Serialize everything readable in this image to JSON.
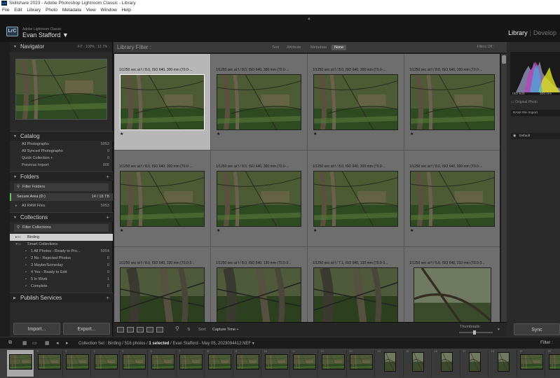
{
  "window": {
    "title": "Skillshare 2023 - Adobe Photoshop Lightroom Classic - Library",
    "app_icon": "Lrc"
  },
  "menu": [
    "File",
    "Edit",
    "Library",
    "Photo",
    "Metadata",
    "View",
    "Window",
    "Help"
  ],
  "identity": {
    "logo": "LrC",
    "product": "Adobe Lightroom Classic",
    "user": "Evan Stafford",
    "user_caret": "▼",
    "modules": [
      "Library",
      "Develop"
    ],
    "module_separator": "|",
    "active_module": "Library"
  },
  "navigator": {
    "title": "Navigator",
    "zoom": "FIT  :  100%  :  12.7%  :"
  },
  "catalog": {
    "title": "Catalog",
    "items": [
      {
        "label": "All Photographs",
        "count": "5053"
      },
      {
        "label": "All Synced Photographs",
        "count": "0"
      },
      {
        "label": "Quick Collection +",
        "count": "0"
      },
      {
        "label": "Previous Import",
        "count": "806"
      }
    ]
  },
  "folders": {
    "title": "Folders",
    "filter_label": "Filter Folders",
    "volume": {
      "label": "Secure Area (D:)",
      "count": "14 / 18 TB"
    },
    "items": [
      {
        "label": "All RAW Files",
        "count": "5053"
      }
    ]
  },
  "collections": {
    "title": "Collections",
    "filter_label": "Filter Collections",
    "items": [
      {
        "label": "Birding",
        "count": ""
      },
      {
        "label": "Smart Collections",
        "count": ""
      },
      {
        "label": "1 All Photos - Ready to Pro...",
        "count": "5054"
      },
      {
        "label": "2 No - Rejected Photos",
        "count": "0"
      },
      {
        "label": "3 Maybe/Someday",
        "count": "0"
      },
      {
        "label": "4 Yes - Ready to Edit",
        "count": "0"
      },
      {
        "label": "5 In Work",
        "count": "1"
      },
      {
        "label": "Complete",
        "count": "0"
      }
    ]
  },
  "publish_services": {
    "title": "Publish Services"
  },
  "buttons": {
    "import": "Import...",
    "export": "Export...",
    "sync": "Sync"
  },
  "library_filter": {
    "title": "Library Filter :",
    "options": [
      "Text",
      "Attribute",
      "Metadata",
      "None"
    ],
    "selected": "None",
    "status": "Filters Off :"
  },
  "grid": {
    "cells": [
      {
        "caption": "1/1250 sec at f / 8.0, ISO 640, 300 mm (70.0-...",
        "star": "★",
        "selected": true,
        "scene": "a"
      },
      {
        "caption": "1/1250 sec at f / 8.0, ISO 640, 300 mm (70.0-...",
        "star": "★",
        "selected": false,
        "scene": "a"
      },
      {
        "caption": "1/1250 sec at f / 8.0, ISO 640, 300 mm (70.0-...",
        "star": "★",
        "selected": false,
        "scene": "a"
      },
      {
        "caption": "1/1250 sec at f / 8.0, ISO 640, 300 mm (70.0-...",
        "star": "★",
        "selected": false,
        "scene": "a"
      },
      {
        "caption": "1/1250 sec at f / 8.0, ISO 640, 300 mm (70.0-...",
        "star": "★",
        "selected": false,
        "scene": "a"
      },
      {
        "caption": "1/1250 sec at f / 8.0, ISO 640, 300 mm (70.0-...",
        "star": "★",
        "selected": false,
        "scene": "a"
      },
      {
        "caption": "1/1250 sec at f / 8.0, ISO 640, 300 mm (70.0-...",
        "star": "★",
        "selected": false,
        "scene": "a"
      },
      {
        "caption": "1/1250 sec at f / 8.0, ISO 640, 300 mm (70.0-...",
        "star": "★",
        "selected": false,
        "scene": "a"
      },
      {
        "caption": "1/1250 sec at f / 8.0, ISO 640, 130 mm (70.0-3...",
        "star": "",
        "selected": false,
        "scene": "b"
      },
      {
        "caption": "1/1250 sec at f / 8.0, ISO 640, 130 mm (70.0-3...",
        "star": "",
        "selected": false,
        "scene": "b"
      },
      {
        "caption": "1/1250 sec at f / 7.1, ISO 640, 130 mm (70.0-3...",
        "star": "",
        "selected": false,
        "scene": "b"
      },
      {
        "caption": "1/1250 sec at f / 5.6, ISO 640, 210 mm (70.0-3...",
        "star": "",
        "selected": false,
        "scene": "c"
      }
    ]
  },
  "toolbar": {
    "sort_label": "Sort:",
    "sort_value": "Capture Time ÷",
    "thumbnails_label": "Thumbnails",
    "thumbnail_size": 0.45
  },
  "histogram": {
    "iso": "ISO 640",
    "focal": "300 mm",
    "aperture": "f / 8.0",
    "original_label": "Original Photo",
    "raw_import": "RAW File Import",
    "default_preset": "Default"
  },
  "filmstrip_bar": {
    "source": "Collection Set : Birding",
    "count": "516 photos /",
    "selected": "1 selected",
    "file": "/ Evan Stafford - May 05, 2023094412.NEF",
    "filter": "Filter :"
  },
  "filmstrip": {
    "items": [
      {
        "n": "1",
        "tall": false,
        "sel": true
      },
      {
        "n": "2",
        "tall": false,
        "sel": false
      },
      {
        "n": "3",
        "tall": false,
        "sel": false
      },
      {
        "n": "4",
        "tall": false,
        "sel": false
      },
      {
        "n": "5",
        "tall": false,
        "sel": false
      },
      {
        "n": "6",
        "tall": false,
        "sel": false
      },
      {
        "n": "7",
        "tall": false,
        "sel": false
      },
      {
        "n": "8",
        "tall": false,
        "sel": false
      },
      {
        "n": "9",
        "tall": false,
        "sel": false
      },
      {
        "n": "10",
        "tall": false,
        "sel": false
      },
      {
        "n": "11",
        "tall": false,
        "sel": false
      },
      {
        "n": "12",
        "tall": false,
        "sel": false
      },
      {
        "n": "13",
        "tall": false,
        "sel": false
      },
      {
        "n": "14",
        "tall": true,
        "sel": false
      },
      {
        "n": "15",
        "tall": true,
        "sel": false
      },
      {
        "n": "16",
        "tall": true,
        "sel": false
      },
      {
        "n": "17",
        "tall": true,
        "sel": false
      },
      {
        "n": "18",
        "tall": true,
        "sel": false
      },
      {
        "n": "19",
        "tall": false,
        "sel": false
      },
      {
        "n": "20",
        "tall": false,
        "sel": false
      }
    ]
  },
  "colors": {
    "accent": "#5fbf4a",
    "selected_cell": "#b7b7b7",
    "grid_bg": "#6e6e6e"
  }
}
